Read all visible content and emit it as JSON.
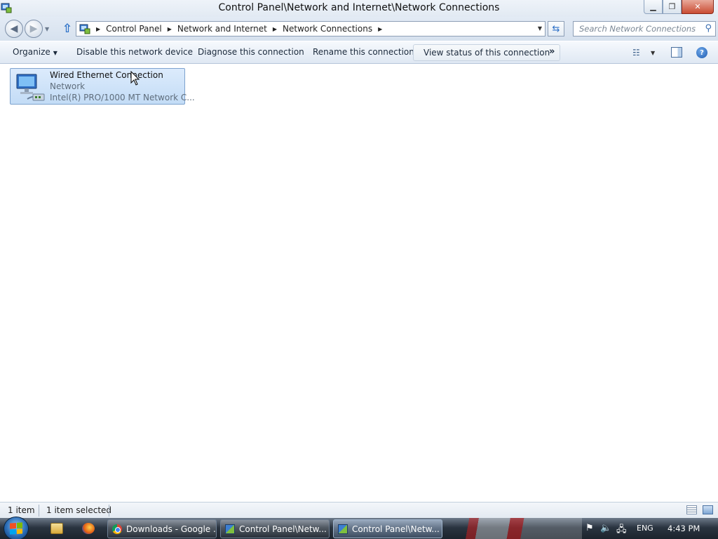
{
  "window": {
    "title": "Control Panel\\Network and Internet\\Network Connections",
    "icon": "control-panel-icon"
  },
  "nav": {
    "breadcrumbs": [
      "Control Panel",
      "Network and Internet",
      "Network Connections"
    ],
    "search_placeholder": "Search Network Connections"
  },
  "commands": {
    "organize": "Organize",
    "disable": "Disable this network device",
    "diagnose": "Diagnose this connection",
    "rename": "Rename this connection",
    "view_status": "View status of this connection",
    "more": "»"
  },
  "connection": {
    "name": "Wired Ethernet Connection",
    "status": "Network",
    "device": "Intel(R) PRO/1000 MT Network C...",
    "selected": true,
    "icon": "network-adapter-icon"
  },
  "statusbar": {
    "count": "1 item",
    "selection": "1 item selected"
  },
  "taskbar": {
    "tasks": [
      {
        "label": "Downloads - Google ...",
        "icon": "chrome-icon",
        "active": false
      },
      {
        "label": "Control Panel\\Netw...",
        "icon": "control-panel-icon",
        "active": false
      },
      {
        "label": "Control Panel\\Netw...",
        "icon": "control-panel-icon",
        "active": true
      }
    ],
    "language": "ENG",
    "clock": "4:43 PM"
  },
  "colors": {
    "selection_fill": "#c9dff8",
    "selection_border": "#7da2ce",
    "command_bar": "#e9eff7",
    "taskbar": "#2a3440"
  }
}
